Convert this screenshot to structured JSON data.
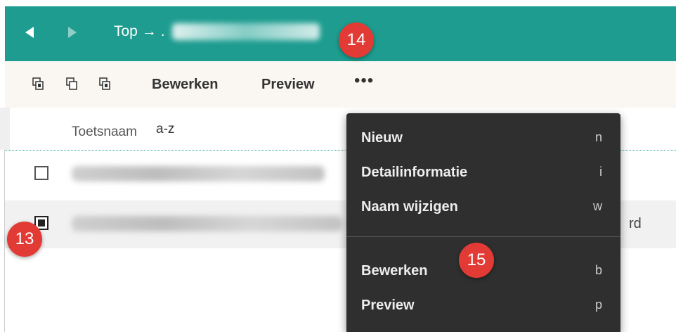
{
  "header": {
    "breadcrumb_root": "Top →",
    "breadcrumb_rest": "."
  },
  "toolbar": {
    "edit_label": "Bewerken",
    "preview_label": "Preview",
    "more_label": "•••"
  },
  "table": {
    "column_title": "Toetsnaam",
    "sort_label": "a-z",
    "rows": [
      {
        "checked": false,
        "suffix": ""
      },
      {
        "checked": true,
        "inline_fragment": "ze",
        "suffix": "rd"
      }
    ]
  },
  "context_menu": {
    "items": [
      {
        "label": "Nieuw",
        "shortcut": "n"
      },
      {
        "label": "Detailinformatie",
        "shortcut": "i"
      },
      {
        "label": "Naam wijzigen",
        "shortcut": "w"
      },
      {
        "label": "Bewerken",
        "shortcut": "b"
      },
      {
        "label": "Preview",
        "shortcut": "p"
      }
    ]
  },
  "annotations": {
    "badge_13": "13",
    "badge_14": "14",
    "badge_15": "15"
  },
  "colors": {
    "accent": "#1d9c8f",
    "menu_bg": "#2f2f2f",
    "badge": "#e23b35"
  }
}
